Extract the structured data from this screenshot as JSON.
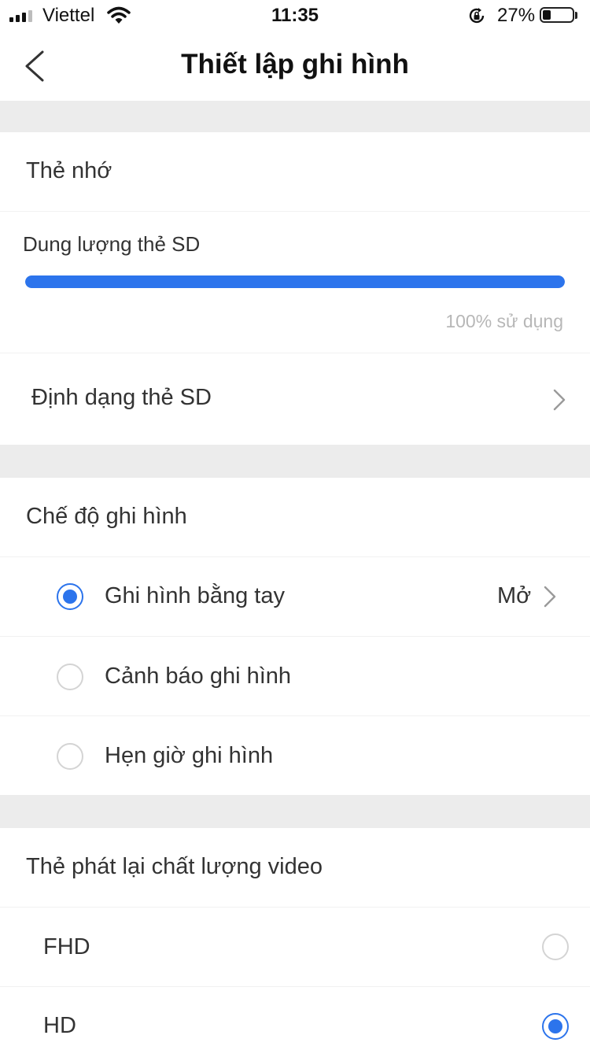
{
  "status_bar": {
    "carrier": "Viettel",
    "time": "11:35",
    "battery_percent": "27%",
    "battery_level": 0.27,
    "signal_bars": 3,
    "icons": [
      "signal-icon",
      "wifi-icon",
      "rotation-lock-icon",
      "battery-icon"
    ]
  },
  "nav": {
    "title": "Thiết lập ghi hình",
    "back_icon": "chevron-left-icon"
  },
  "memory_card": {
    "header": "Thẻ nhớ",
    "capacity_label": "Dung lượng thẻ SD",
    "usage_fraction": 1.0,
    "usage_text": "100% sử dụng",
    "format_label": "Định dạng thẻ SD"
  },
  "recording_mode": {
    "header": "Chế độ ghi hình",
    "options": [
      {
        "label": "Ghi hình bằng tay",
        "value": "Mở",
        "selected": true
      },
      {
        "label": "Cảnh báo ghi hình",
        "selected": false
      },
      {
        "label": "Hẹn giờ ghi hình",
        "selected": false
      }
    ]
  },
  "playback_quality": {
    "header": "Thẻ phát lại chất lượng video",
    "options": [
      {
        "label": "FHD",
        "selected": false
      },
      {
        "label": "HD",
        "selected": true
      }
    ]
  },
  "colors": {
    "accent": "#2c74ec",
    "section_gap": "#ececec",
    "muted_text": "#b7b7b7"
  }
}
